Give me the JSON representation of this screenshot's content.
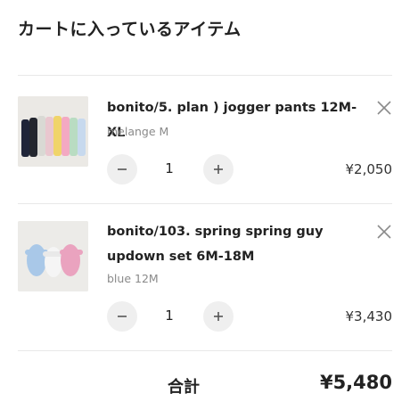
{
  "cart": {
    "title": "カートに入っているアイテム",
    "items": [
      {
        "name": "bonito/5. plan ) jogger pants 12M-XL",
        "variant": "melange M",
        "quantity": "1",
        "price": "¥2,050",
        "thumbnail_icon": "jogger-pants-photo"
      },
      {
        "name": "bonito/103. spring spring guy updown set 6M-18M",
        "variant": "blue 12M",
        "quantity": "1",
        "price": "¥3,430",
        "thumbnail_icon": "baby-rompers-photo"
      }
    ],
    "total_label": "合計",
    "total_value": "¥5,480"
  }
}
